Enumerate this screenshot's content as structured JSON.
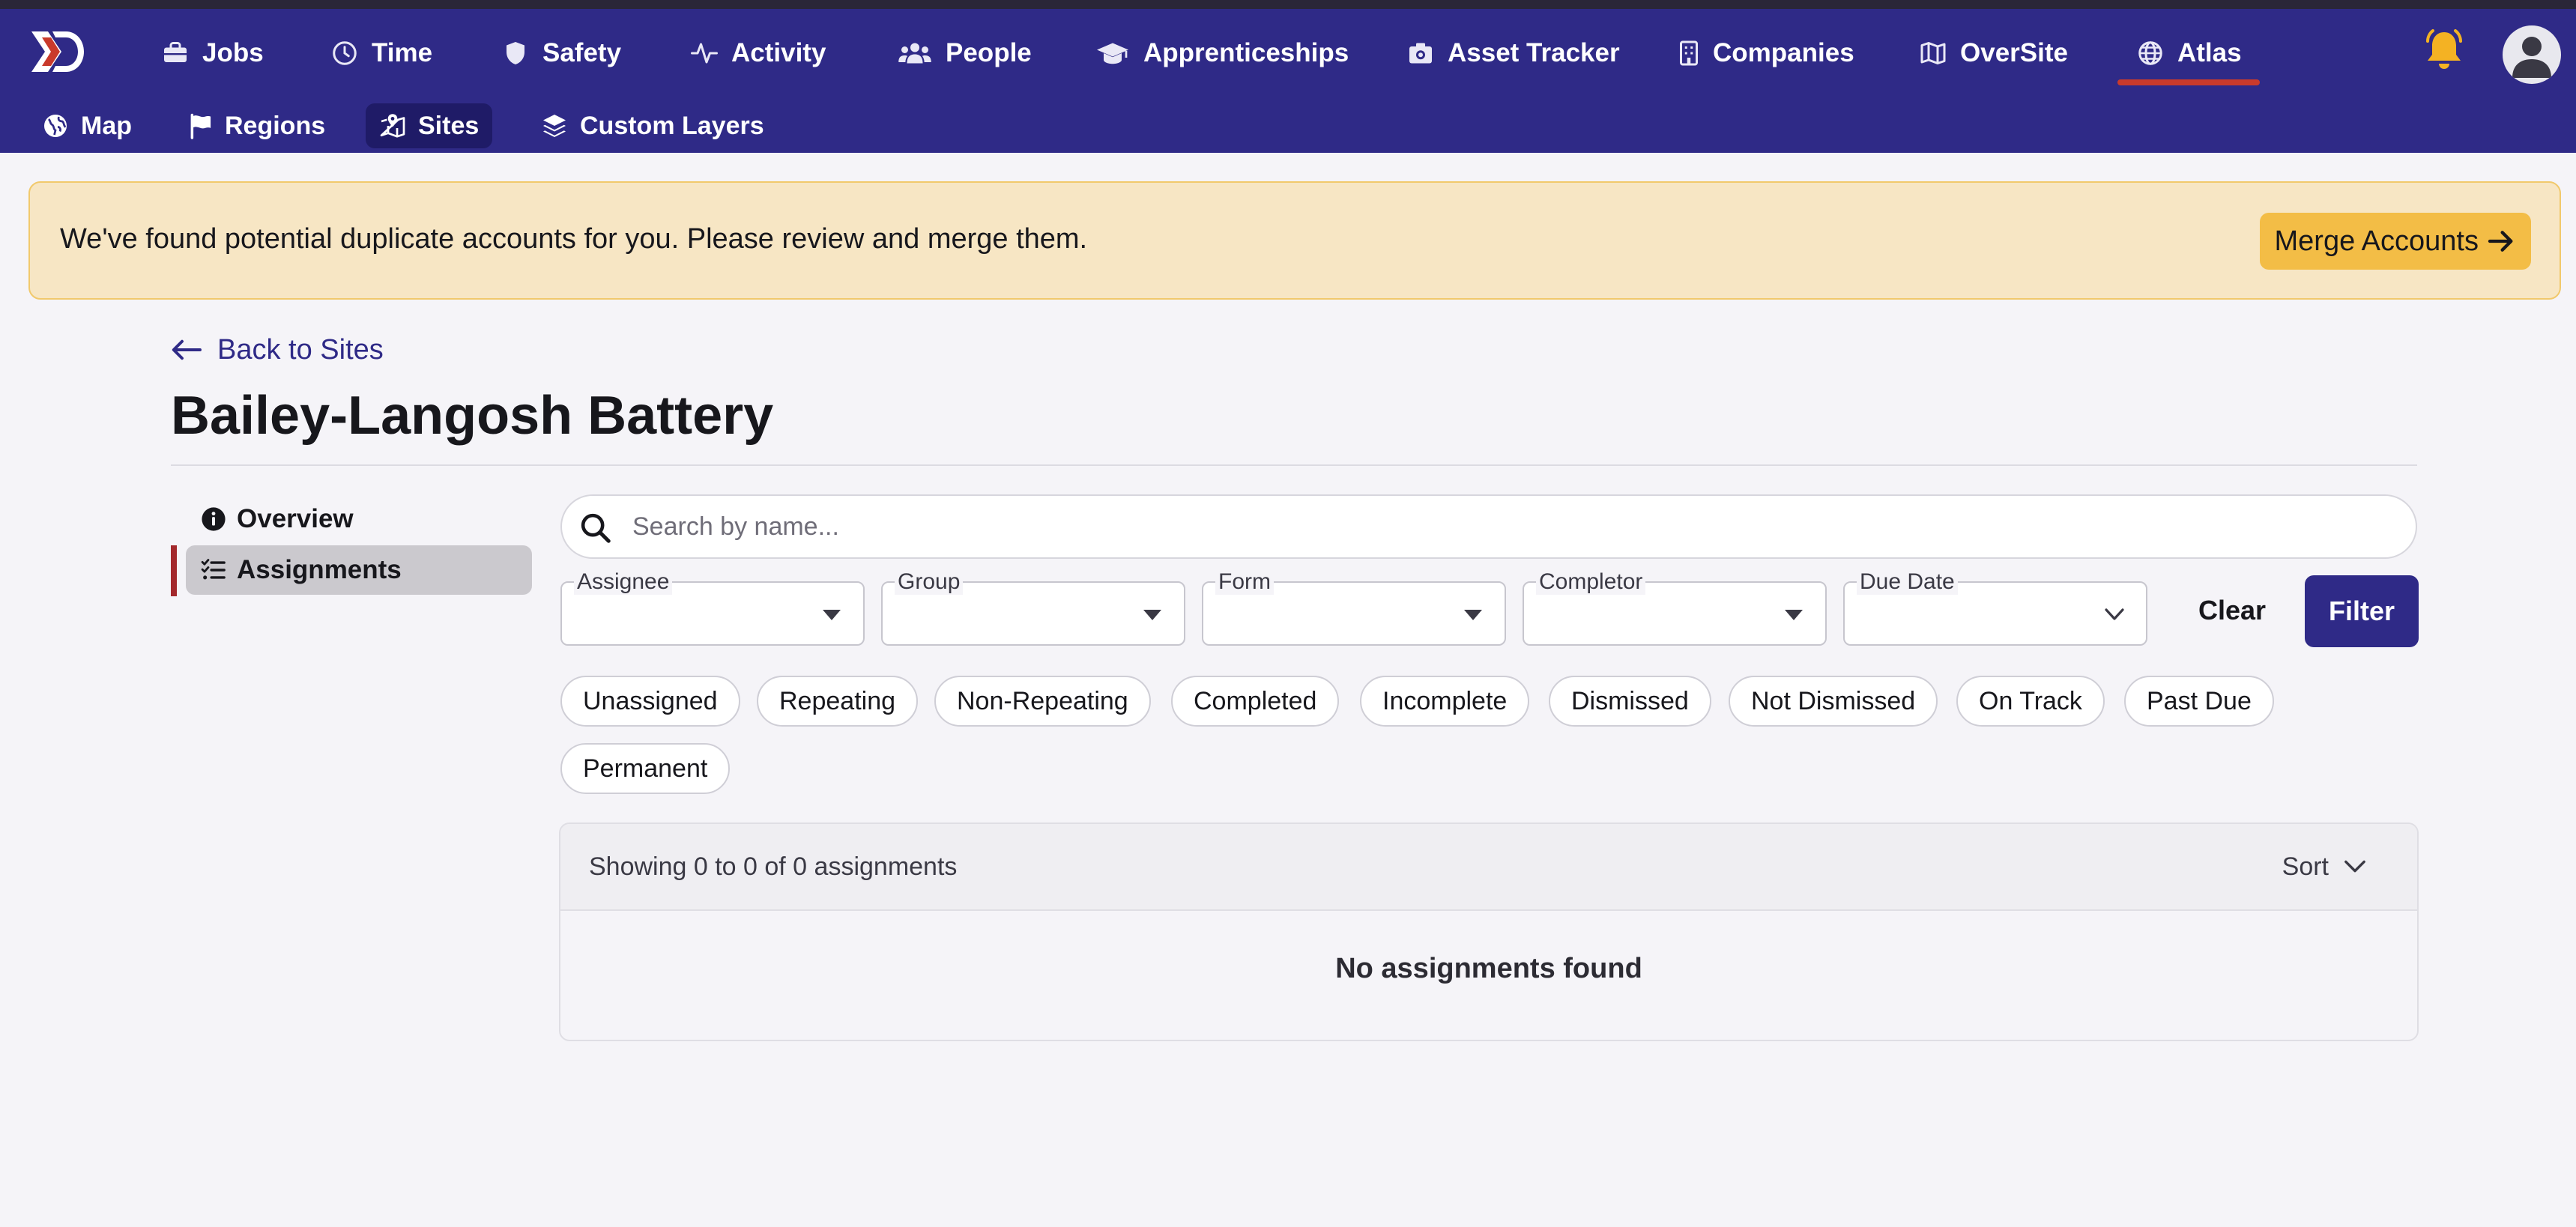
{
  "colors": {
    "nav_bg": "#2f2a87",
    "nav_active_sub_bg": "#1f1b67",
    "active_indicator": "#c93a2b",
    "banner_bg": "#f7e6c4",
    "banner_button": "#f3bd46",
    "bell": "#f4b223",
    "primary_button": "#2f2a87",
    "side_marker": "#a3282c"
  },
  "top_nav": {
    "items": [
      {
        "label": "Jobs",
        "icon": "briefcase-icon"
      },
      {
        "label": "Time",
        "icon": "clock-icon"
      },
      {
        "label": "Safety",
        "icon": "shield-icon"
      },
      {
        "label": "Activity",
        "icon": "pulse-icon"
      },
      {
        "label": "People",
        "icon": "users-icon"
      },
      {
        "label": "Apprenticeships",
        "icon": "graduation-cap-icon"
      },
      {
        "label": "Asset Tracker",
        "icon": "camera-box-icon"
      },
      {
        "label": "Companies",
        "icon": "building-icon"
      },
      {
        "label": "OverSite",
        "icon": "map-icon"
      },
      {
        "label": "Atlas",
        "icon": "globe-icon",
        "active": true
      }
    ]
  },
  "sub_nav": {
    "items": [
      {
        "label": "Map",
        "icon": "earth-icon"
      },
      {
        "label": "Regions",
        "icon": "flag-icon"
      },
      {
        "label": "Sites",
        "icon": "map-location-icon",
        "active": true
      },
      {
        "label": "Custom Layers",
        "icon": "layers-icon"
      }
    ]
  },
  "banner": {
    "message": "We've found potential duplicate accounts for you. Please review and merge them.",
    "button_label": "Merge Accounts"
  },
  "page": {
    "back_label": "Back to Sites",
    "title": "Bailey-Langosh Battery"
  },
  "side_menu": {
    "items": [
      {
        "label": "Overview",
        "icon": "info-circle-icon"
      },
      {
        "label": "Assignments",
        "icon": "checklist-icon",
        "active": true
      }
    ]
  },
  "search": {
    "placeholder": "Search by name...",
    "value": ""
  },
  "filters": {
    "selects": [
      {
        "label": "Assignee",
        "value": "",
        "caret": "caret-down-icon"
      },
      {
        "label": "Group",
        "value": "",
        "caret": "caret-down-icon"
      },
      {
        "label": "Form",
        "value": "",
        "caret": "caret-down-icon"
      },
      {
        "label": "Completor",
        "value": "",
        "caret": "caret-down-icon"
      },
      {
        "label": "Due Date",
        "value": "",
        "caret": "chevron-down-icon"
      }
    ],
    "clear_label": "Clear",
    "filter_label": "Filter"
  },
  "chips": [
    "Unassigned",
    "Repeating",
    "Non-Repeating",
    "Completed",
    "Incomplete",
    "Dismissed",
    "Not Dismissed",
    "On Track",
    "Past Due",
    "Permanent"
  ],
  "results": {
    "summary": "Showing 0 to 0 of 0 assignments",
    "sort_label": "Sort",
    "empty_message": "No assignments found"
  }
}
